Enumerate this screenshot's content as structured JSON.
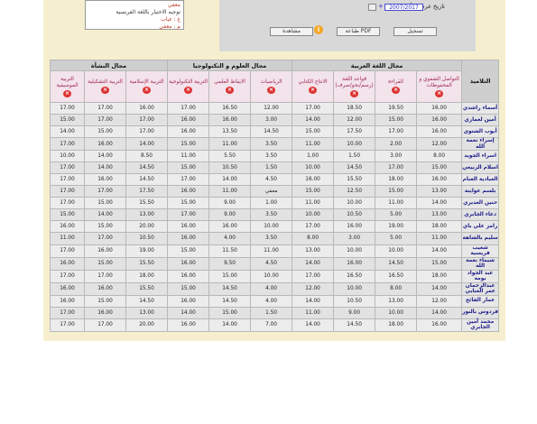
{
  "legend": {
    "items": [
      {
        "code": "",
        "label": "معفي"
      },
      {
        "code": "",
        "label": "توجيه الاختيار باللغة الفرنسية"
      },
      {
        "code": "غ",
        "label": "غياب"
      },
      {
        "code": "م",
        "label": "معفي"
      }
    ]
  },
  "panel": {
    "grade_date_label": "تاريخ عرض الأعداد :",
    "date_value": "2007/2017",
    "buttons": {
      "save": "تسجيل",
      "print_pdf": "طباعة PDF",
      "preview": "مشاهدة"
    },
    "info_glyph": "i"
  },
  "table": {
    "domains": {
      "students": "التلاميذ",
      "arabic": "مجال اللغة العربية",
      "science": "مجال العلوم و التكنولوجيا",
      "social": "مجال النشأة"
    },
    "subjects": [
      "التواصل الشفوي و المحفوظات",
      "القراءة",
      "قواعد اللغة (رسم/نحو/صرف)",
      "الانتاج الكتابي",
      "الرياضيات",
      "الايقاظ العلمي",
      "التربية التكنولوجية",
      "التربية الإسلامية",
      "التربية التشكيلية",
      "التربية الموسيقية"
    ],
    "rows": [
      {
        "name": "أسماء راشدي",
        "scores": [
          "16.00",
          "19.50",
          "18.50",
          "17.00",
          "12.00",
          "16.50",
          "17.00",
          "16.00",
          "17.00",
          "17.00"
        ]
      },
      {
        "name": "أمين لعماري",
        "scores": [
          "16.00",
          "15.00",
          "12.00",
          "14.00",
          "3.00",
          "16.00",
          "16.00",
          "17.00",
          "17.00",
          "15.00"
        ]
      },
      {
        "name": "أيوب الشتوي",
        "scores": [
          "16.00",
          "17.00",
          "17.50",
          "15.00",
          "14.50",
          "13.50",
          "16.00",
          "17.00",
          "15.00",
          "14.00"
        ]
      },
      {
        "name": "إسراء نعمة الله",
        "scores": [
          "12.00",
          "2.00",
          "10.00",
          "11.00",
          "3.50",
          "11.00",
          "15.00",
          "14.00",
          "16.00",
          "17.00"
        ]
      },
      {
        "name": "اسراء الجويد",
        "scores": [
          "8.00",
          "3.00",
          "1.50",
          "1.00",
          "3.50",
          "5.50",
          "11.00",
          "8.50",
          "14.00",
          "10.00"
        ]
      },
      {
        "name": "اسلام الربيعي",
        "scores": [
          "15.00",
          "17.00",
          "14.50",
          "10.00",
          "1.50",
          "10.50",
          "15.00",
          "14.50",
          "14.00",
          "17.00"
        ]
      },
      {
        "name": "العبادية الغنام",
        "scores": [
          "16.00",
          "18.00",
          "15.50",
          "16.00",
          "4.50",
          "14.00",
          "17.00",
          "14.50",
          "16.00",
          "17.00"
        ]
      },
      {
        "name": "بلسم عواينة",
        "scores": [
          "13.00",
          "15.00",
          "12.50",
          "15.00",
          "معفي",
          "11.00",
          "16.00",
          "17.50",
          "17.00",
          "17.00"
        ]
      },
      {
        "name": "حنين الغديري",
        "scores": [
          "14.00",
          "11.00",
          "10.00",
          "11.00",
          "1.00",
          "9.00",
          "15.00",
          "15.50",
          "15.00",
          "17.00"
        ]
      },
      {
        "name": "دعاء الجابري",
        "scores": [
          "13.00",
          "5.00",
          "10.50",
          "10.00",
          "3.50",
          "9.00",
          "17.00",
          "13.00",
          "14.00",
          "15.00"
        ]
      },
      {
        "name": "رامز علي باي",
        "scores": [
          "18.00",
          "19.00",
          "16.00",
          "17.00",
          "10.00",
          "16.00",
          "16.00",
          "20.00",
          "15.00",
          "16.00"
        ]
      },
      {
        "name": "سليم بالشاهة",
        "scores": [
          "11.00",
          "5.00",
          "3.00",
          "8.00",
          "3.50",
          "4.00",
          "16.00",
          "10.50",
          "17.00",
          "11.00"
        ]
      },
      {
        "name": "شعيب فريسية",
        "scores": [
          "14.00",
          "10.00",
          "10.00",
          "13.00",
          "11.00",
          "11.50",
          "15.00",
          "19.00",
          "16.00",
          "17.00"
        ]
      },
      {
        "name": "شيماء نعمة الله",
        "scores": [
          "15.00",
          "14.50",
          "16.00",
          "14.00",
          "4.50",
          "9.50",
          "16.00",
          "15.50",
          "15.00",
          "16.00"
        ]
      },
      {
        "name": "عبد الجواد بومة",
        "scores": [
          "18.00",
          "16.50",
          "16.50",
          "17.00",
          "10.00",
          "15.00",
          "16.00",
          "18.00",
          "17.00",
          "17.00"
        ]
      },
      {
        "name": "عبدالرحمان عمر العنابي",
        "scores": [
          "14.00",
          "8.00",
          "10.00",
          "12.00",
          "4.00",
          "14.50",
          "15.00",
          "15.50",
          "16.00",
          "16.00"
        ]
      },
      {
        "name": "عمار الفائح",
        "scores": [
          "12.00",
          "13.00",
          "10.50",
          "14.00",
          "4.00",
          "14.50",
          "16.00",
          "14.50",
          "15.00",
          "16.00"
        ]
      },
      {
        "name": "فردوس بالنور",
        "scores": [
          "14.00",
          "10.00",
          "9.00",
          "11.00",
          "1.50",
          "15.00",
          "14.00",
          "13.00",
          "16.00",
          "17.00"
        ]
      },
      {
        "name": "محمد أمين الجابري",
        "scores": [
          "16.00",
          "18.00",
          "14.50",
          "14.00",
          "7.00",
          "14.00",
          "16.00",
          "20.00",
          "17.00",
          "17.00"
        ]
      }
    ]
  },
  "colors": {
    "frame_bg": "#f6efcf",
    "header_pink": "#f3e3ea",
    "subject_text": "#a02656",
    "delete_icon": "#dd3333"
  },
  "icons": {
    "delete": "close-icon",
    "info": "info-icon"
  }
}
